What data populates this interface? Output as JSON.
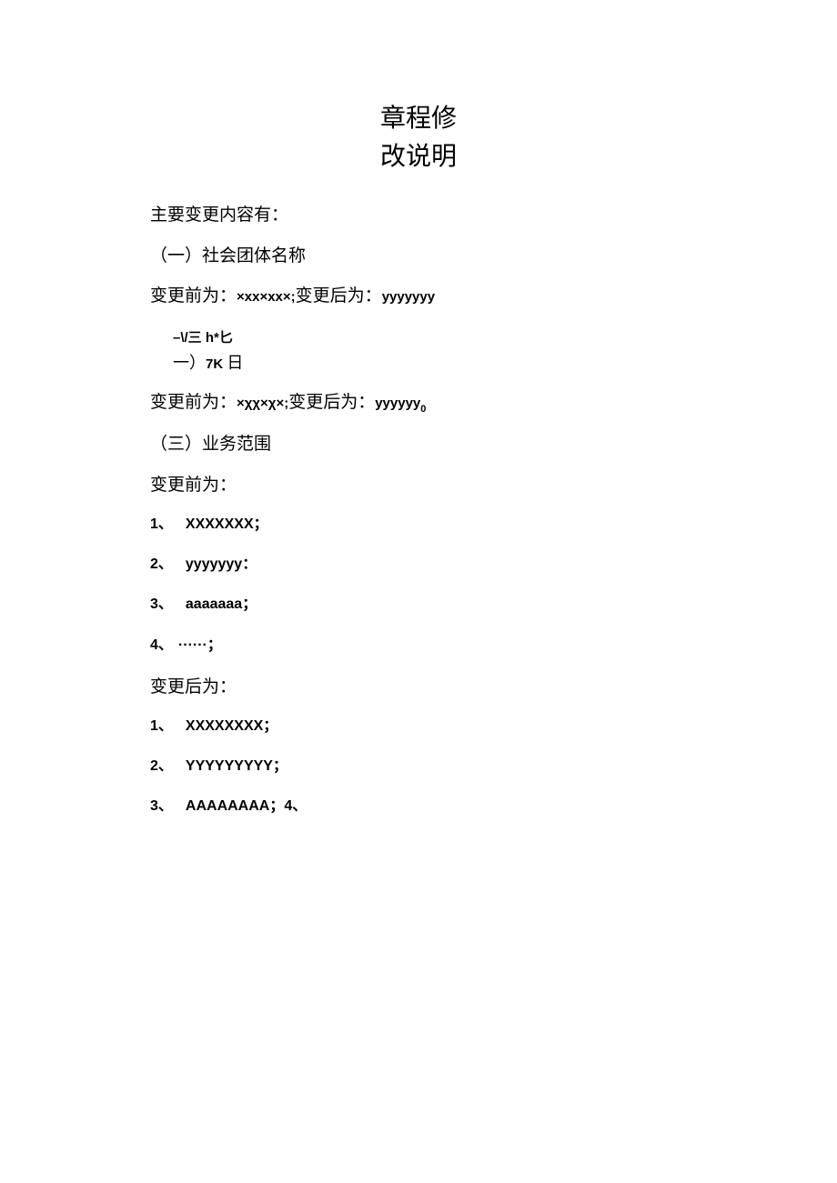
{
  "title_line1": "章程修",
  "title_line2": "改说明",
  "intro": "主要变更内容有：",
  "section1": {
    "heading": "（一）社会团体名称",
    "before_label": "变更前为：",
    "before_value": "×xx×xx×;",
    "after_label": "变更后为：",
    "after_value": "yyyyyyy"
  },
  "section2": {
    "garble_line1": "–\\/三 h*匕",
    "garble_line2": "一）7K 日",
    "before_label": "变更前为：",
    "before_value": "×χχ×χ×;",
    "after_label": "变更后为：",
    "after_value": "yyyyyy",
    "after_suffix": "0"
  },
  "section3": {
    "heading": "（三）业务范围",
    "before_label": "变更前为：",
    "before_items": [
      {
        "num": "1、",
        "text": "XXXXXXX；"
      },
      {
        "num": "2、",
        "text": "yyyyyyy："
      },
      {
        "num": "3、",
        "text": "aaaaaaa；"
      },
      {
        "num": "4、",
        "text": "······；"
      }
    ],
    "after_label": "变更后为：",
    "after_items": [
      {
        "num": "1、",
        "text": "XXXXXXXX；"
      },
      {
        "num": "2、",
        "text": "YYYYYYYYY；"
      },
      {
        "num": "3、",
        "text": "AAAAAAAA；4、"
      }
    ]
  }
}
